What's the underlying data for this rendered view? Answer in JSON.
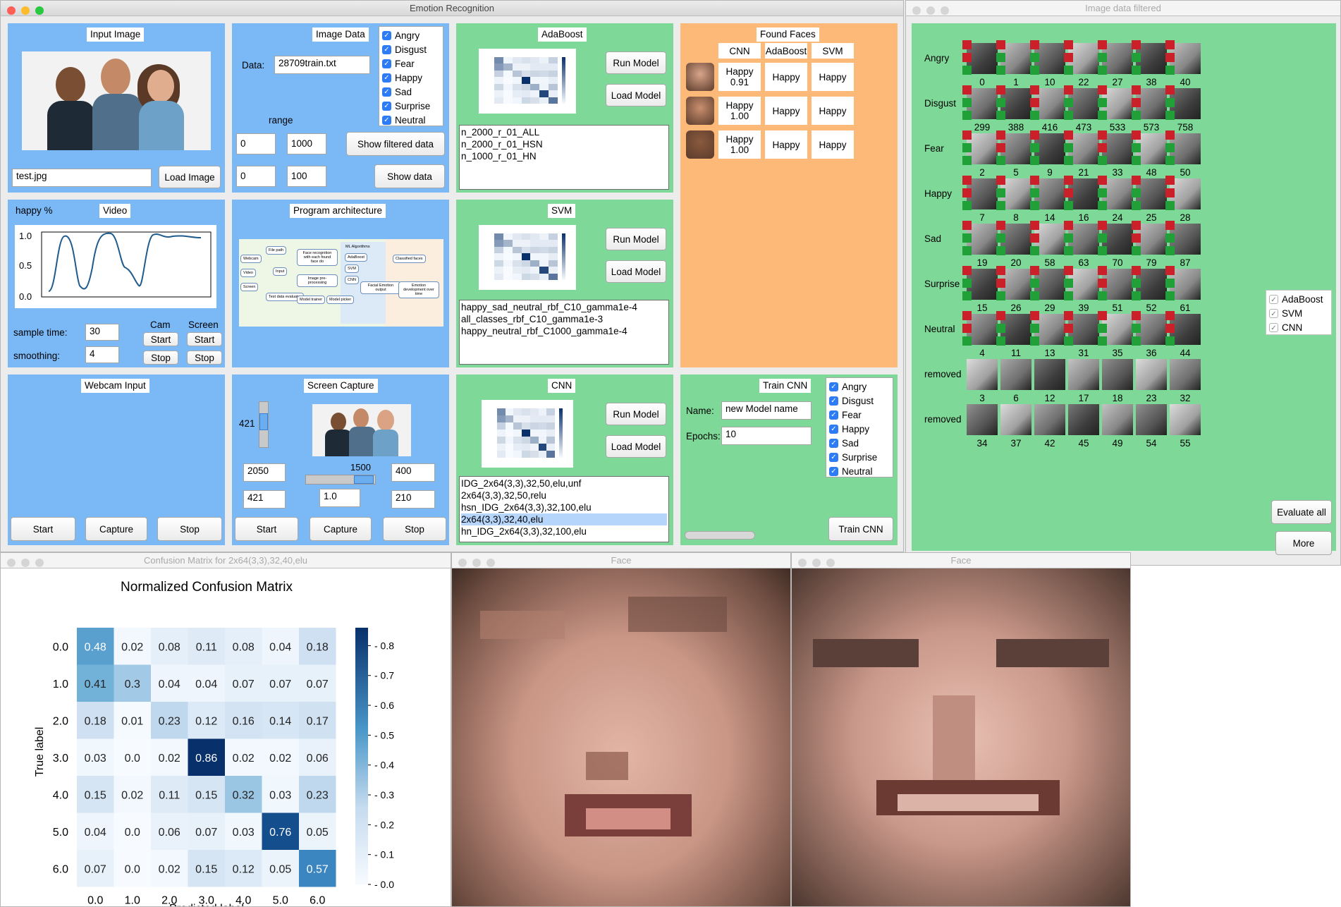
{
  "main_window": {
    "title": "Emotion Recognition",
    "input_image": {
      "title": "Input Image",
      "file": "test.jpg",
      "load_label": "Load Image"
    },
    "image_data": {
      "title": "Image Data",
      "data_label": "Data:",
      "data_value": "28709train.txt",
      "range_label": "range",
      "range": [
        "0",
        "1000",
        "0",
        "100"
      ],
      "show_filtered_label": "Show filtered data",
      "show_data_label": "Show data",
      "emotions": [
        "Angry",
        "Disgust",
        "Fear",
        "Happy",
        "Sad",
        "Surprise",
        "Neutral"
      ]
    },
    "adaboost": {
      "title": "AdaBoost",
      "run_label": "Run Model",
      "load_label": "Load Model",
      "models": [
        "n_2000_r_01_ALL",
        "n_2000_r_01_HSN",
        "n_1000_r_01_HN"
      ]
    },
    "found_faces": {
      "title": "Found Faces",
      "columns": [
        "CNN",
        "AdaBoost",
        "SVM"
      ],
      "rows": [
        {
          "cnn": "Happy",
          "conf": "0.91",
          "ada": "Happy",
          "svm": "Happy"
        },
        {
          "cnn": "Happy",
          "conf": "1.00",
          "ada": "Happy",
          "svm": "Happy"
        },
        {
          "cnn": "Happy",
          "conf": "1.00",
          "ada": "Happy",
          "svm": "Happy"
        }
      ]
    },
    "video": {
      "title": "Video",
      "ylabel": "happy %",
      "ticks": [
        "1.0",
        "0.5",
        "0.0"
      ],
      "sample_label": "sample time:",
      "sample_value": "30",
      "smoothing_label": "smoothing:",
      "smoothing_value": "4",
      "cam_label": "Cam",
      "screen_label": "Screen",
      "start_label": "Start",
      "stop_label": "Stop"
    },
    "architecture": {
      "title": "Program architecture",
      "nodes": [
        "Webcam",
        "Video",
        "Screen",
        "File path",
        "Input",
        "Test data evaluator",
        "Face recognition with each found face do",
        "Image pre-processing",
        "Model trainer",
        "Model picker",
        "ML Algorithms",
        "AdaBoost",
        "SVM",
        "CNN",
        "Classified faces",
        "Facial Emotion output",
        "Emotion development over time"
      ]
    },
    "svm": {
      "title": "SVM",
      "run_label": "Run Model",
      "load_label": "Load Model",
      "models": [
        "happy_sad_neutral_rbf_C10_gamma1e-4",
        "all_classes_rbf_C10_gamma1e-3",
        "happy_neutral_rbf_C1000_gamma1e-4"
      ]
    },
    "webcam": {
      "title": "Webcam Input",
      "start_label": "Start",
      "capture_label": "Capture",
      "stop_label": "Stop"
    },
    "screen_capture": {
      "title": "Screen Capture",
      "spinner_value": "421",
      "fields": [
        "2050",
        "421",
        "400",
        "210"
      ],
      "slider_value": "1500",
      "scale_value": "1.0",
      "start_label": "Start",
      "capture_label": "Capture",
      "stop_label": "Stop"
    },
    "cnn": {
      "title": "CNN",
      "run_label": "Run Model",
      "load_label": "Load Model",
      "models": [
        "IDG_2x64(3,3),32,50,elu,unf",
        "2x64(3,3),32,50,relu",
        "hsn_IDG_2x64(3,3),32,100,elu",
        "2x64(3,3),32,40,elu",
        "hn_IDG_2x64(3,3),32,100,elu"
      ],
      "selected_index": 3
    },
    "train_cnn": {
      "title": "Train CNN",
      "name_label": "Name:",
      "name_value": "new Model name",
      "epochs_label": "Epochs:",
      "epochs_value": "10",
      "train_label": "Train CNN",
      "emotions": [
        "Angry",
        "Disgust",
        "Fear",
        "Happy",
        "Sad",
        "Surprise",
        "Neutral"
      ]
    }
  },
  "filtered_window": {
    "title": "Image data filtered",
    "rows": [
      {
        "label": "Angry",
        "ids": [
          "0",
          "1",
          "10",
          "22",
          "27",
          "38",
          "40"
        ]
      },
      {
        "label": "Disgust",
        "ids": [
          "299",
          "388",
          "416",
          "473",
          "533",
          "573",
          "758"
        ]
      },
      {
        "label": "Fear",
        "ids": [
          "2",
          "5",
          "9",
          "21",
          "33",
          "48",
          "50"
        ]
      },
      {
        "label": "Happy",
        "ids": [
          "7",
          "8",
          "14",
          "16",
          "24",
          "25",
          "28"
        ]
      },
      {
        "label": "Sad",
        "ids": [
          "19",
          "20",
          "58",
          "63",
          "70",
          "79",
          "87"
        ]
      },
      {
        "label": "Surprise",
        "ids": [
          "15",
          "26",
          "29",
          "39",
          "51",
          "52",
          "61"
        ]
      },
      {
        "label": "Neutral",
        "ids": [
          "4",
          "11",
          "13",
          "31",
          "35",
          "36",
          "44"
        ]
      },
      {
        "label": "removed",
        "ids": [
          "3",
          "6",
          "12",
          "17",
          "18",
          "23",
          "32"
        ]
      },
      {
        "label": "removed",
        "ids": [
          "34",
          "37",
          "42",
          "45",
          "49",
          "54",
          "55"
        ]
      }
    ],
    "classifiers": [
      "AdaBoost",
      "SVM",
      "CNN"
    ],
    "evaluate_label": "Evaluate all",
    "more_label": "More"
  },
  "confusion_window": {
    "title": "Confusion Matrix for 2x64(3,3),32,40,elu"
  },
  "chart_data": {
    "type": "heatmap",
    "title": "Normalized Confusion Matrix",
    "xlabel": "Predicted label",
    "ylabel": "True label",
    "x_ticks": [
      "0.0",
      "1.0",
      "2.0",
      "3.0",
      "4.0",
      "5.0",
      "6.0"
    ],
    "y_ticks": [
      "0.0",
      "1.0",
      "2.0",
      "3.0",
      "4.0",
      "5.0",
      "6.0"
    ],
    "values": [
      [
        "0.48",
        "0.02",
        "0.08",
        "0.11",
        "0.08",
        "0.04",
        "0.18"
      ],
      [
        "0.41",
        "0.3",
        "0.04",
        "0.04",
        "0.07",
        "0.07",
        "0.07"
      ],
      [
        "0.18",
        "0.01",
        "0.23",
        "0.12",
        "0.16",
        "0.14",
        "0.17"
      ],
      [
        "0.03",
        "0.0",
        "0.02",
        "0.86",
        "0.02",
        "0.02",
        "0.06"
      ],
      [
        "0.15",
        "0.02",
        "0.11",
        "0.15",
        "0.32",
        "0.03",
        "0.23"
      ],
      [
        "0.04",
        "0.0",
        "0.06",
        "0.07",
        "0.03",
        "0.76",
        "0.05"
      ],
      [
        "0.07",
        "0.0",
        "0.02",
        "0.15",
        "0.12",
        "0.05",
        "0.57"
      ]
    ],
    "colorbar_ticks": [
      "0.8",
      "0.7",
      "0.6",
      "0.5",
      "0.4",
      "0.3",
      "0.2",
      "0.1",
      "0.0"
    ],
    "colorbar_range": [
      0,
      0.86
    ]
  },
  "face_windows": [
    {
      "title": "Face"
    },
    {
      "title": "Face"
    }
  ],
  "colors": {
    "blue_panel": "#7ab8f6",
    "green_panel": "#7ed897",
    "orange_panel": "#fdb977",
    "check": "#2d7cf5"
  }
}
